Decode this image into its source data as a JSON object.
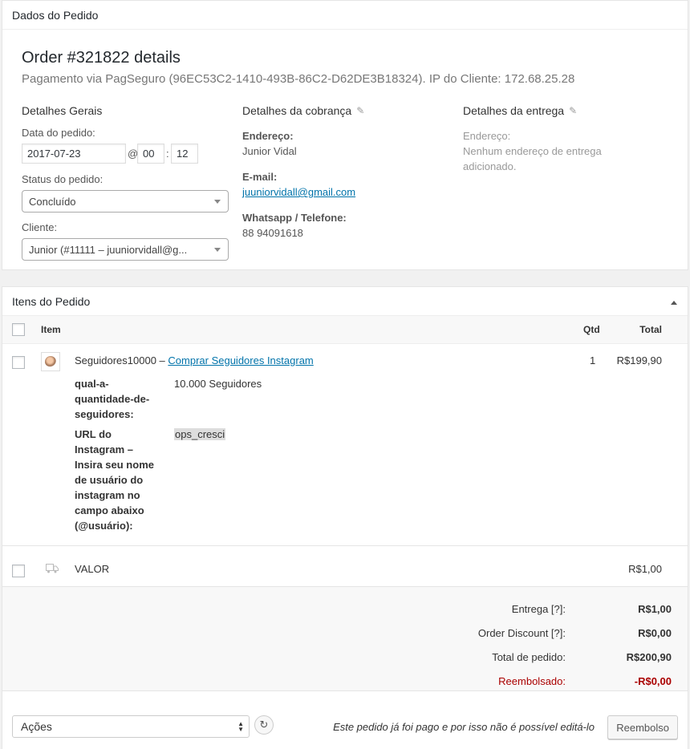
{
  "order_panel": {
    "heading": "Dados do Pedido",
    "title": "Order #321822 details",
    "subtitle": "Pagamento via PagSeguro (96EC53C2-1410-493B-86C2-D62DE3B18324). IP do Cliente: 172.68.25.28",
    "general": {
      "heading": "Detalhes Gerais",
      "date_label": "Data do pedido:",
      "date_value": "2017-07-23",
      "at_symbol": "@",
      "hour": "00",
      "colon": ":",
      "minute": "12",
      "status_label": "Status do pedido:",
      "status_value": "Concluído",
      "customer_label": "Cliente:",
      "customer_value": "Junior (#11111 – juuniorvidall@g..."
    },
    "billing": {
      "heading": "Detalhes da cobrança",
      "address_label": "Endereço:",
      "address_value": "Junior Vidal",
      "email_label": "E-mail:",
      "email_value": "juuniorvidall@gmail.com",
      "phone_label": "Whatsapp / Telefone:",
      "phone_value": "88 94091618"
    },
    "shipping": {
      "heading": "Detalhes da entrega",
      "address_label": "Endereço:",
      "address_value_line1": "Nenhum endereço de entrega",
      "address_value_line2": "adicionado."
    }
  },
  "items_panel": {
    "heading": "Itens do Pedido",
    "columns": {
      "item": "Item",
      "qty": "Qtd",
      "total": "Total"
    },
    "line_item": {
      "name_prefix": "Seguidores10000 –",
      "name_link": "Comprar Seguidores Instagram",
      "qty": "1",
      "total": "R$199,90",
      "meta": [
        {
          "key_lines": [
            "qual-a-",
            "quantidade-de-",
            "seguidores:"
          ],
          "value": "10.000 Seguidores"
        },
        {
          "key_lines": [
            "URL do",
            "Instagram –",
            "Insira seu nome",
            "de usuário do",
            "instagram no",
            "campo abaixo",
            "(@usuário):"
          ],
          "value": "ops_cresci"
        }
      ]
    },
    "shipping_item": {
      "name": "VALOR",
      "total": "R$1,00"
    },
    "totals": [
      {
        "label": "Entrega [?]:",
        "value": "R$1,00"
      },
      {
        "label": "Order Discount [?]:",
        "value": "R$0,00"
      },
      {
        "label": "Total de pedido:",
        "value": "R$200,90"
      },
      {
        "label": "Reembolsado:",
        "value": "-R$0,00",
        "color": "#aa0000"
      }
    ],
    "actions": {
      "select_value": "Ações",
      "note": "Este pedido já foi pago e por isso não é possível editá-lo",
      "refund_button": "Reembolso"
    }
  }
}
